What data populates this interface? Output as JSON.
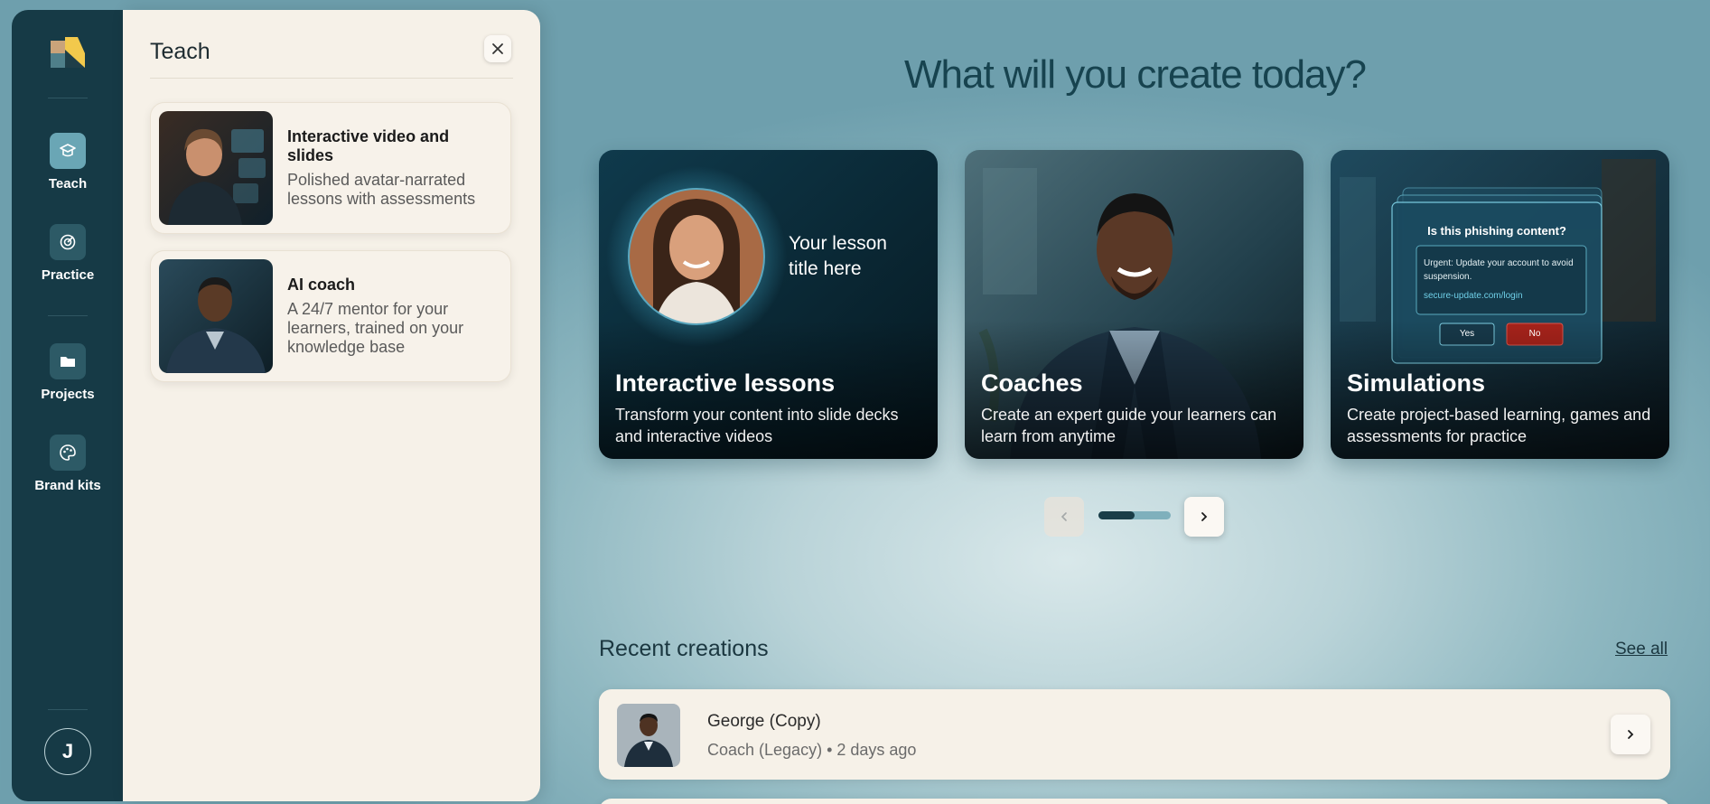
{
  "nav": {
    "items": [
      {
        "label": "Teach",
        "icon": "graduation-cap-icon"
      },
      {
        "label": "Practice",
        "icon": "target-icon"
      },
      {
        "label": "Projects",
        "icon": "folder-icon"
      },
      {
        "label": "Brand kits",
        "icon": "palette-icon"
      }
    ],
    "user_initial": "J"
  },
  "panel": {
    "title": "Teach",
    "options": [
      {
        "title": "Interactive video and slides",
        "desc": "Polished avatar-narrated lessons with assessments"
      },
      {
        "title": "AI coach",
        "desc": "A 24/7 mentor for your learners, trained on your knowledge base"
      }
    ]
  },
  "main": {
    "headline": "What will you create today?",
    "templates": [
      {
        "title": "Interactive lessons",
        "desc": "Transform your content into slide decks and interactive videos",
        "preview_text": "Your lesson title here"
      },
      {
        "title": "Coaches",
        "desc": "Create an expert guide your learners can learn from anytime"
      },
      {
        "title": "Simulations",
        "desc": "Create project-based learning, games and assessments for practice",
        "preview": {
          "question": "Is this phishing content?",
          "message": "Urgent: Update your account to avoid suspension.",
          "link": "secure-update.com/login",
          "yes": "Yes",
          "no": "No"
        }
      }
    ],
    "carousel_progress": 0.5
  },
  "recent": {
    "title": "Recent creations",
    "see_all": "See all",
    "items": [
      {
        "name": "George (Copy)",
        "meta": "Coach (Legacy) • 2 days ago"
      }
    ]
  },
  "colors": {
    "rail": "#163a46",
    "panel": "#f6f1e8",
    "accent": "#6aa6b5",
    "danger": "#a8231b"
  }
}
